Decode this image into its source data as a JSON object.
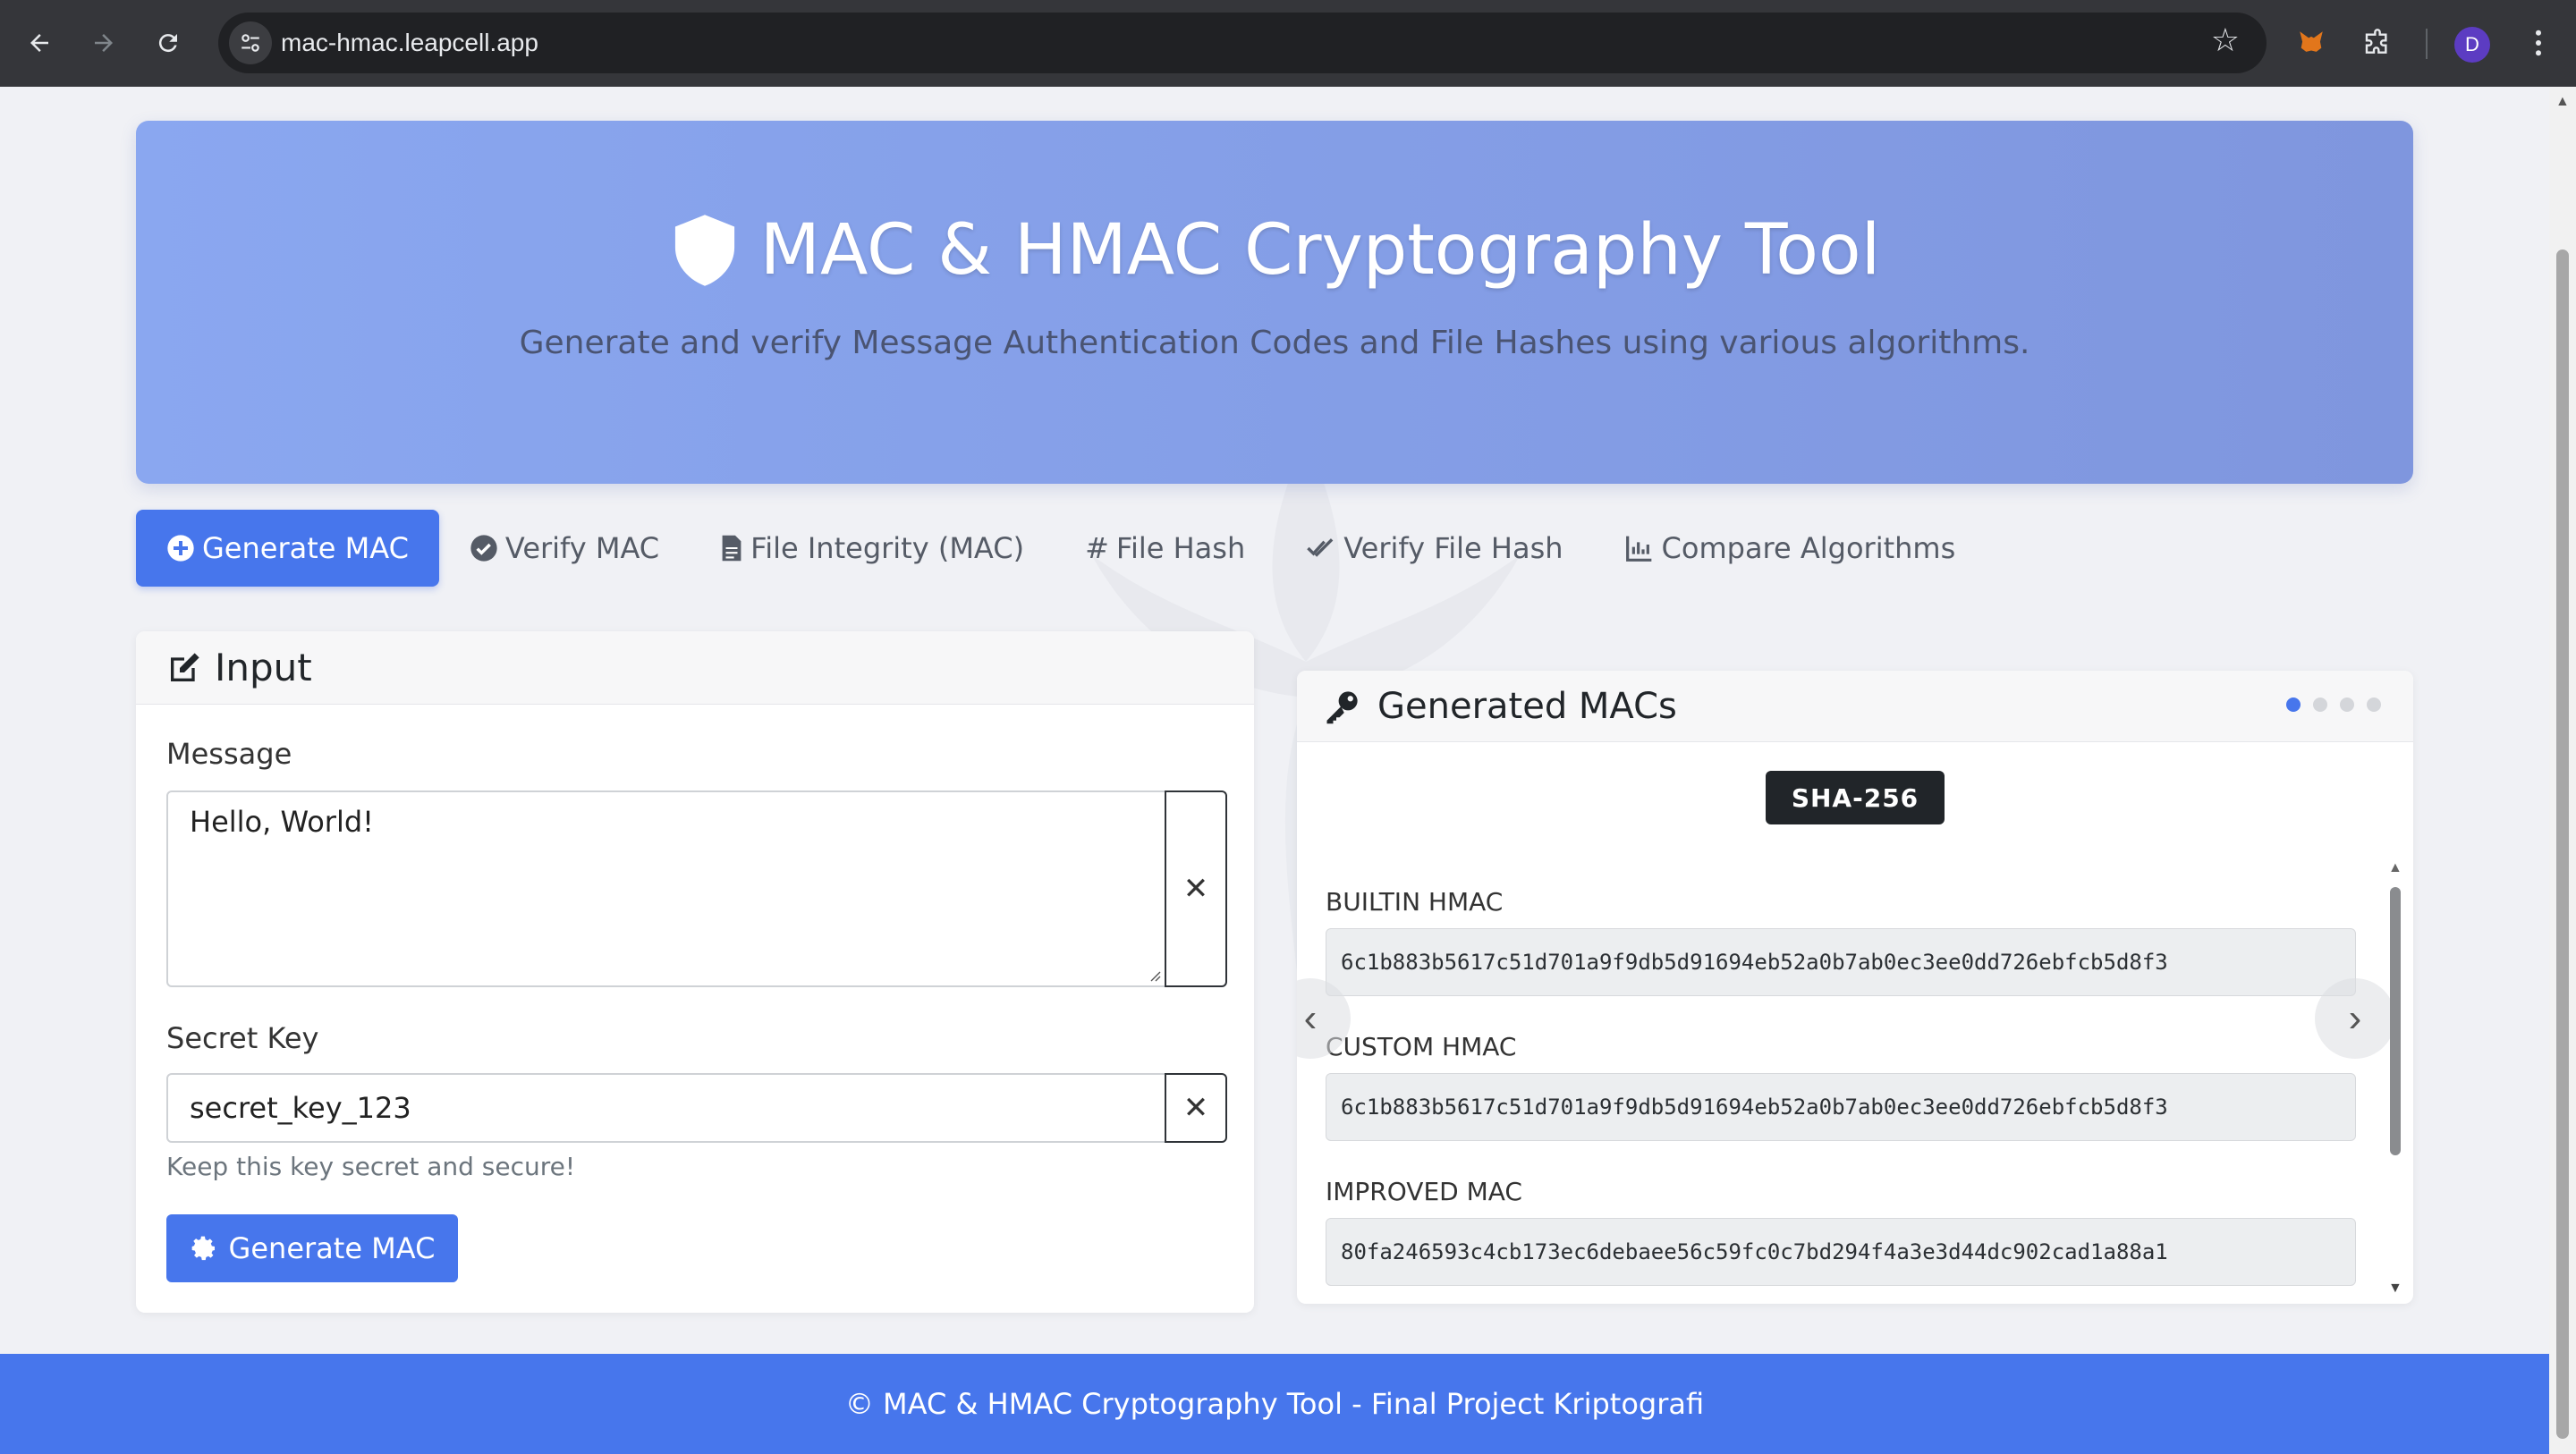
{
  "browser": {
    "url": "mac-hmac.leapcell.app",
    "profile_initial": "D"
  },
  "hero": {
    "title": "MAC & HMAC Cryptography Tool",
    "subtitle": "Generate and verify Message Authentication Codes and File Hashes using various algorithms."
  },
  "tabs": [
    {
      "label": "Generate MAC",
      "icon": "plus-circle-icon",
      "active": true
    },
    {
      "label": "Verify MAC",
      "icon": "check-circle-icon",
      "active": false
    },
    {
      "label": "File Integrity (MAC)",
      "icon": "file-icon",
      "active": false
    },
    {
      "label": "File Hash",
      "icon": "hash-icon",
      "active": false
    },
    {
      "label": "Verify File Hash",
      "icon": "double-check-icon",
      "active": false
    },
    {
      "label": "Compare Algorithms",
      "icon": "chart-icon",
      "active": false
    }
  ],
  "input_card": {
    "title": "Input",
    "message_label": "Message",
    "message_value": "Hello, World!",
    "secret_key_label": "Secret Key",
    "secret_key_value": "secret_key_123",
    "secret_key_hint": "Keep this key secret and secure!",
    "generate_button": "Generate MAC"
  },
  "output_card": {
    "title": "Generated MACs",
    "algorithm_badge": "SHA-256",
    "carousel_slides": 4,
    "carousel_active_index": 0,
    "results": [
      {
        "label": "BUILTIN HMAC",
        "value": "6c1b883b5617c51d701a9f9db5d91694eb52a0b7ab0ec3ee0dd726ebfcb5d8f3"
      },
      {
        "label": "CUSTOM HMAC",
        "value": "6c1b883b5617c51d701a9f9db5d91694eb52a0b7ab0ec3ee0dd726ebfcb5d8f3"
      },
      {
        "label": "IMPROVED MAC",
        "value": "80fa246593c4cb173ec6debaee56c59fc0c7bd294f4a3e3d44dc902cad1a88a1"
      }
    ]
  },
  "footer": {
    "text": "© MAC & HMAC Cryptography Tool - Final Project Kriptografi"
  },
  "colors": {
    "primary": "#4776ec",
    "hero_gradient_start": "#8aa7f0",
    "hero_gradient_end": "#7f96de",
    "badge_bg": "#212529"
  }
}
